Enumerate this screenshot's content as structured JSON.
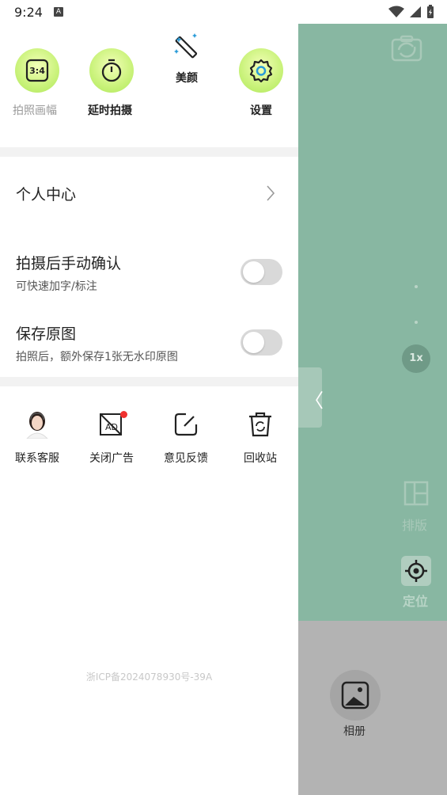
{
  "status_bar": {
    "time": "9:24",
    "notification_letter": "A"
  },
  "drawer": {
    "top_actions": [
      {
        "label": "拍照画幅",
        "badge": "3:4",
        "style": "gray"
      },
      {
        "label": "延时拍摄",
        "style": "bold"
      },
      {
        "label": "美颜",
        "style": "bold"
      },
      {
        "label": "设置",
        "style": "bold"
      }
    ],
    "personal_center": {
      "label": "个人中心"
    },
    "manual_confirm": {
      "title": "拍摄后手动确认",
      "subtitle": "可快速加字/标注",
      "enabled": false
    },
    "save_original": {
      "title": "保存原图",
      "subtitle": "拍照后，额外保存1张无水印原图",
      "enabled": false
    },
    "tools": [
      {
        "label": "联系客服",
        "icon": "customer-service-avatar-icon"
      },
      {
        "label": "关闭广告",
        "icon": "no-ads-icon",
        "badge_color": "#f0312f"
      },
      {
        "label": "意见反馈",
        "icon": "edit-feedback-icon"
      },
      {
        "label": "回收站",
        "icon": "recycle-bin-icon"
      }
    ],
    "icp": "浙ICP备2024078930号-39A"
  },
  "camera": {
    "zoom": "1x",
    "layout_label": "排版",
    "locate_label": "定位",
    "album_label": "相册"
  },
  "colors": {
    "accent_green": "#c9f27a",
    "camera_bg": "#88b7a2",
    "bottom_bg": "#b3b3b3"
  }
}
